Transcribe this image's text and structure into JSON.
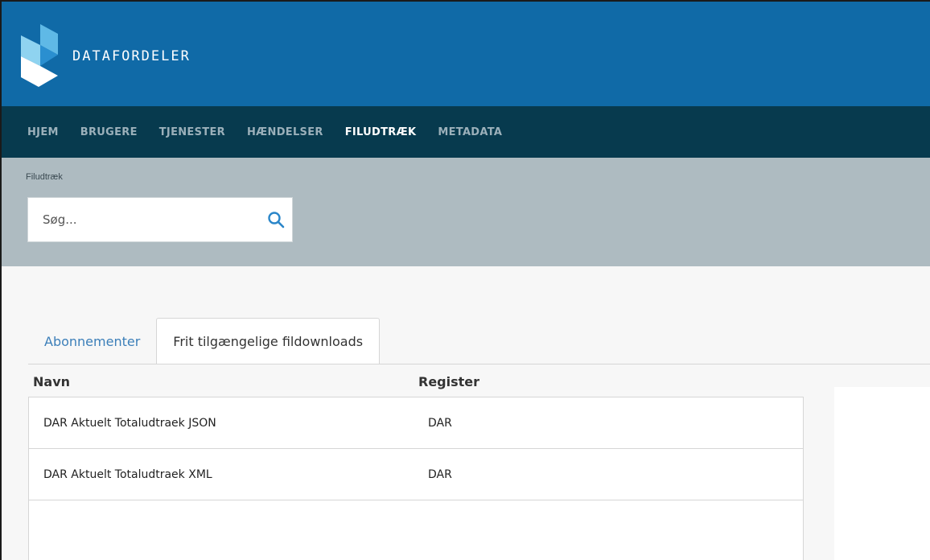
{
  "brand": {
    "name": "DATAFORDELER"
  },
  "nav": {
    "items": [
      {
        "label": "HJEM",
        "active": false
      },
      {
        "label": "BRUGERE",
        "active": false
      },
      {
        "label": "TJENESTER",
        "active": false
      },
      {
        "label": "HÆNDELSER",
        "active": false
      },
      {
        "label": "FILUDTRÆK",
        "active": true
      },
      {
        "label": "METADATA",
        "active": false
      }
    ]
  },
  "breadcrumb": "Filudtræk",
  "search": {
    "placeholder": "Søg...",
    "value": "",
    "icon": "search-icon"
  },
  "tabs": [
    {
      "label": "Abonnementer",
      "active": false
    },
    {
      "label": "Frit tilgængelige fildownloads",
      "active": true
    }
  ],
  "table": {
    "columns": [
      "Navn",
      "Register"
    ],
    "rows": [
      {
        "navn": "DAR Aktuelt Totaludtraek JSON",
        "register": "DAR"
      },
      {
        "navn": "DAR Aktuelt Totaludtraek XML",
        "register": "DAR"
      }
    ]
  },
  "colors": {
    "header": "#106aa7",
    "nav": "#073a4e",
    "subheader": "#aebbc1",
    "link": "#3c7fb9",
    "search_icon": "#2a86c9"
  }
}
